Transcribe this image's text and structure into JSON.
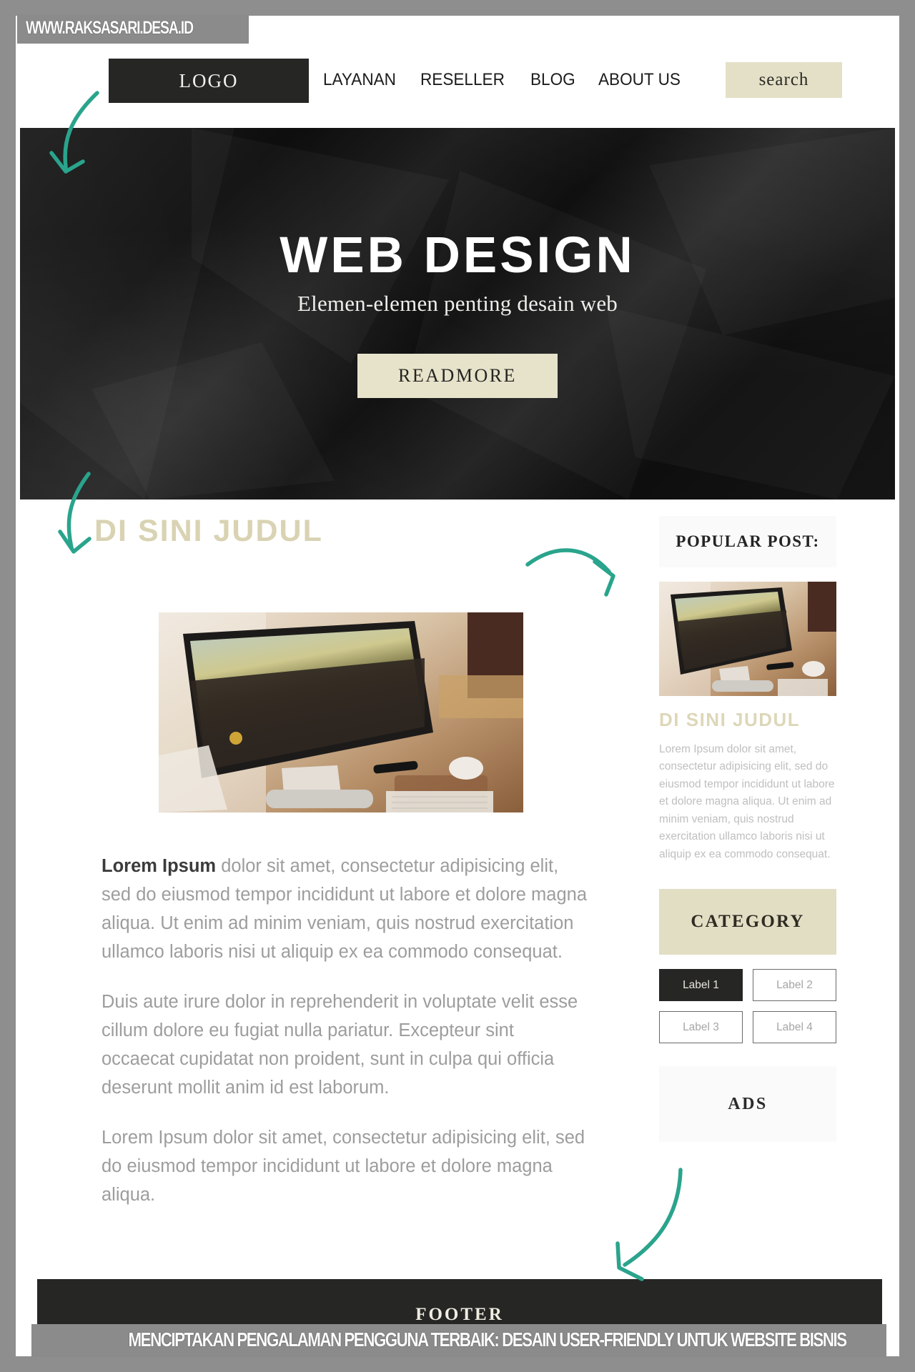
{
  "watermark": {
    "top_url": "WWW.RAKSASARI.DESA.ID",
    "bottom_caption": "MENCIPTAKAN PENGALAMAN PENGGUNA TERBAIK: DESAIN USER-FRIENDLY UNTUK WEBSITE BISNIS"
  },
  "header": {
    "logo": "LOGO",
    "nav": [
      {
        "label": "LAYANAN"
      },
      {
        "label": "RESELLER"
      },
      {
        "label": "BLOG"
      },
      {
        "label": "ABOUT US"
      }
    ],
    "search_label": "search"
  },
  "hero": {
    "title": "WEB DESIGN",
    "subtitle": "Elemen-elemen penting desain web",
    "cta_label": "READMORE"
  },
  "main": {
    "heading": "DI SINI JUDUL",
    "photo_alt": "desktop-computer-on-desk-photo",
    "paragraphs": {
      "p1_lead": "Lorem Ipsum",
      "p1_rest": " dolor sit amet, consectetur adipisicing elit, sed do eiusmod tempor incididunt ut labore et dolore magna aliqua. Ut enim ad minim veniam, quis nostrud exercitation ullamco laboris nisi ut aliquip ex ea commodo consequat.",
      "p2": "Duis aute irure dolor in reprehenderit in voluptate velit esse cillum dolore eu fugiat nulla pariatur. Excepteur sint occaecat cupidatat non proident, sunt in culpa qui officia deserunt mollit anim id est laborum.",
      "p3": "Lorem Ipsum dolor sit amet, consectetur adipisicing elit, sed do eiusmod tempor incididunt ut labore et dolore magna aliqua."
    }
  },
  "sidebar": {
    "popular_post_title": "POPULAR POST:",
    "popular_photo_alt": "desktop-computer-thumbnail-photo",
    "popular_item_title": "DI SINI JUDUL",
    "popular_item_text": "Lorem Ipsum dolor sit amet, consectetur adipisicing elit, sed do eiusmod tempor incididunt ut labore et dolore magna aliqua. Ut enim ad minim veniam, quis nostrud exercitation ullamco laboris nisi ut aliquip ex ea commodo consequat.",
    "category_title": "CATEGORY",
    "labels": [
      {
        "text": "Label 1",
        "active": true
      },
      {
        "text": "Label 2",
        "active": false
      },
      {
        "text": "Label 3",
        "active": false
      },
      {
        "text": "Label 4",
        "active": false
      }
    ],
    "ads_label": "ADS"
  },
  "footer": {
    "label": "FOOTER"
  },
  "colors": {
    "accent_cream": "#e4e0c7",
    "dark": "#262625",
    "heading_tan": "#d9d3b3",
    "annotation_teal": "#2aa48c",
    "watermark_grey": "#8b8b8b"
  },
  "annotations": [
    {
      "name": "arrow-to-hero",
      "from": "logo",
      "to": "hero-banner"
    },
    {
      "name": "arrow-to-heading",
      "from": "hero-bottom",
      "to": "di-sini-judul-heading"
    },
    {
      "name": "arrow-to-popular-post",
      "from": "content-mid",
      "to": "popular-post-box"
    },
    {
      "name": "arrow-to-footer",
      "from": "ads-box",
      "to": "footer-bar"
    }
  ]
}
